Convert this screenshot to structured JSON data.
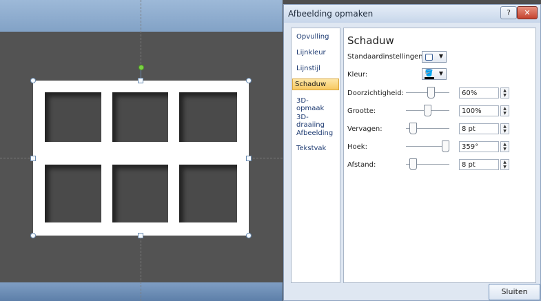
{
  "dialog": {
    "title": "Afbeelding opmaken",
    "help_label": "?",
    "close_label": "✕",
    "close_button": "Sluiten"
  },
  "nav": {
    "items": [
      "Opvulling",
      "Lijnkleur",
      "Lijnstijl",
      "Schaduw",
      "3D-opmaak",
      "3D-draaiing",
      "Afbeelding",
      "Tekstvak"
    ],
    "active": "Schaduw"
  },
  "shadow": {
    "title": "Schaduw",
    "preset_label": "Standaardinstellingen:",
    "color_label": "Kleur:",
    "transparency": {
      "label": "Doorzichtigheid:",
      "value": "60%",
      "level": 0.6
    },
    "size": {
      "label": "Grootte:",
      "value": "100%",
      "level": 0.5
    },
    "blur": {
      "label": "Vervagen:",
      "value": "8 pt",
      "level": 0.1
    },
    "angle": {
      "label": "Hoek:",
      "value": "359°",
      "level": 1.0
    },
    "distance": {
      "label": "Afstand:",
      "value": "8 pt",
      "level": 0.1
    }
  },
  "icons": {
    "preset": "shadow-preset-icon",
    "color": "paint-bucket-icon",
    "dropdown": "chevron-down-icon",
    "spin_up": "spin-up-icon",
    "spin_down": "spin-down-icon"
  }
}
